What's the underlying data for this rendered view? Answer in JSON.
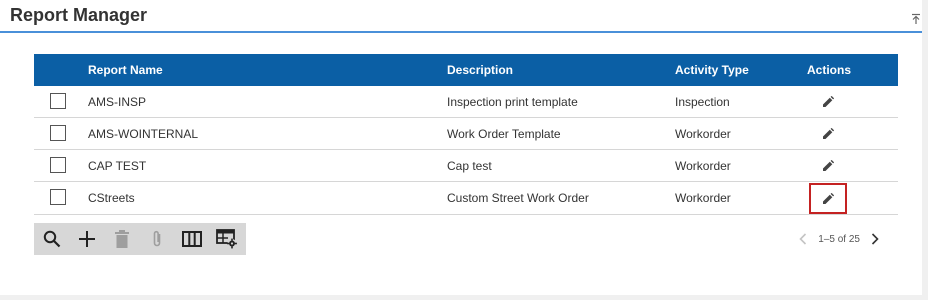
{
  "header": {
    "title": "Report Manager"
  },
  "table": {
    "columns": {
      "name": "Report Name",
      "description": "Description",
      "activity_type": "Activity Type",
      "actions": "Actions"
    },
    "rows": [
      {
        "name": "AMS-INSP",
        "description": "Inspection print template",
        "activity_type": "Inspection"
      },
      {
        "name": "AMS-WOINTERNAL",
        "description": "Work Order Template",
        "activity_type": "Workorder"
      },
      {
        "name": "CAP TEST",
        "description": "Cap test",
        "activity_type": "Workorder"
      },
      {
        "name": "CStreets",
        "description": "Custom Street Work Order",
        "activity_type": "Workorder"
      }
    ]
  },
  "pager": {
    "range": "1–5 of 25"
  },
  "colors": {
    "header_bg": "#0b5fa5",
    "accent_border": "#4a90d9",
    "highlight": "#c42222",
    "toolbar_bg": "#d7d7d7"
  },
  "icons": [
    "collapse-up-icon",
    "edit-pencil-icon",
    "search-icon",
    "add-icon",
    "trash-icon",
    "paperclip-icon",
    "columns-icon",
    "table-settings-icon",
    "chevron-left-icon",
    "chevron-right-icon"
  ]
}
